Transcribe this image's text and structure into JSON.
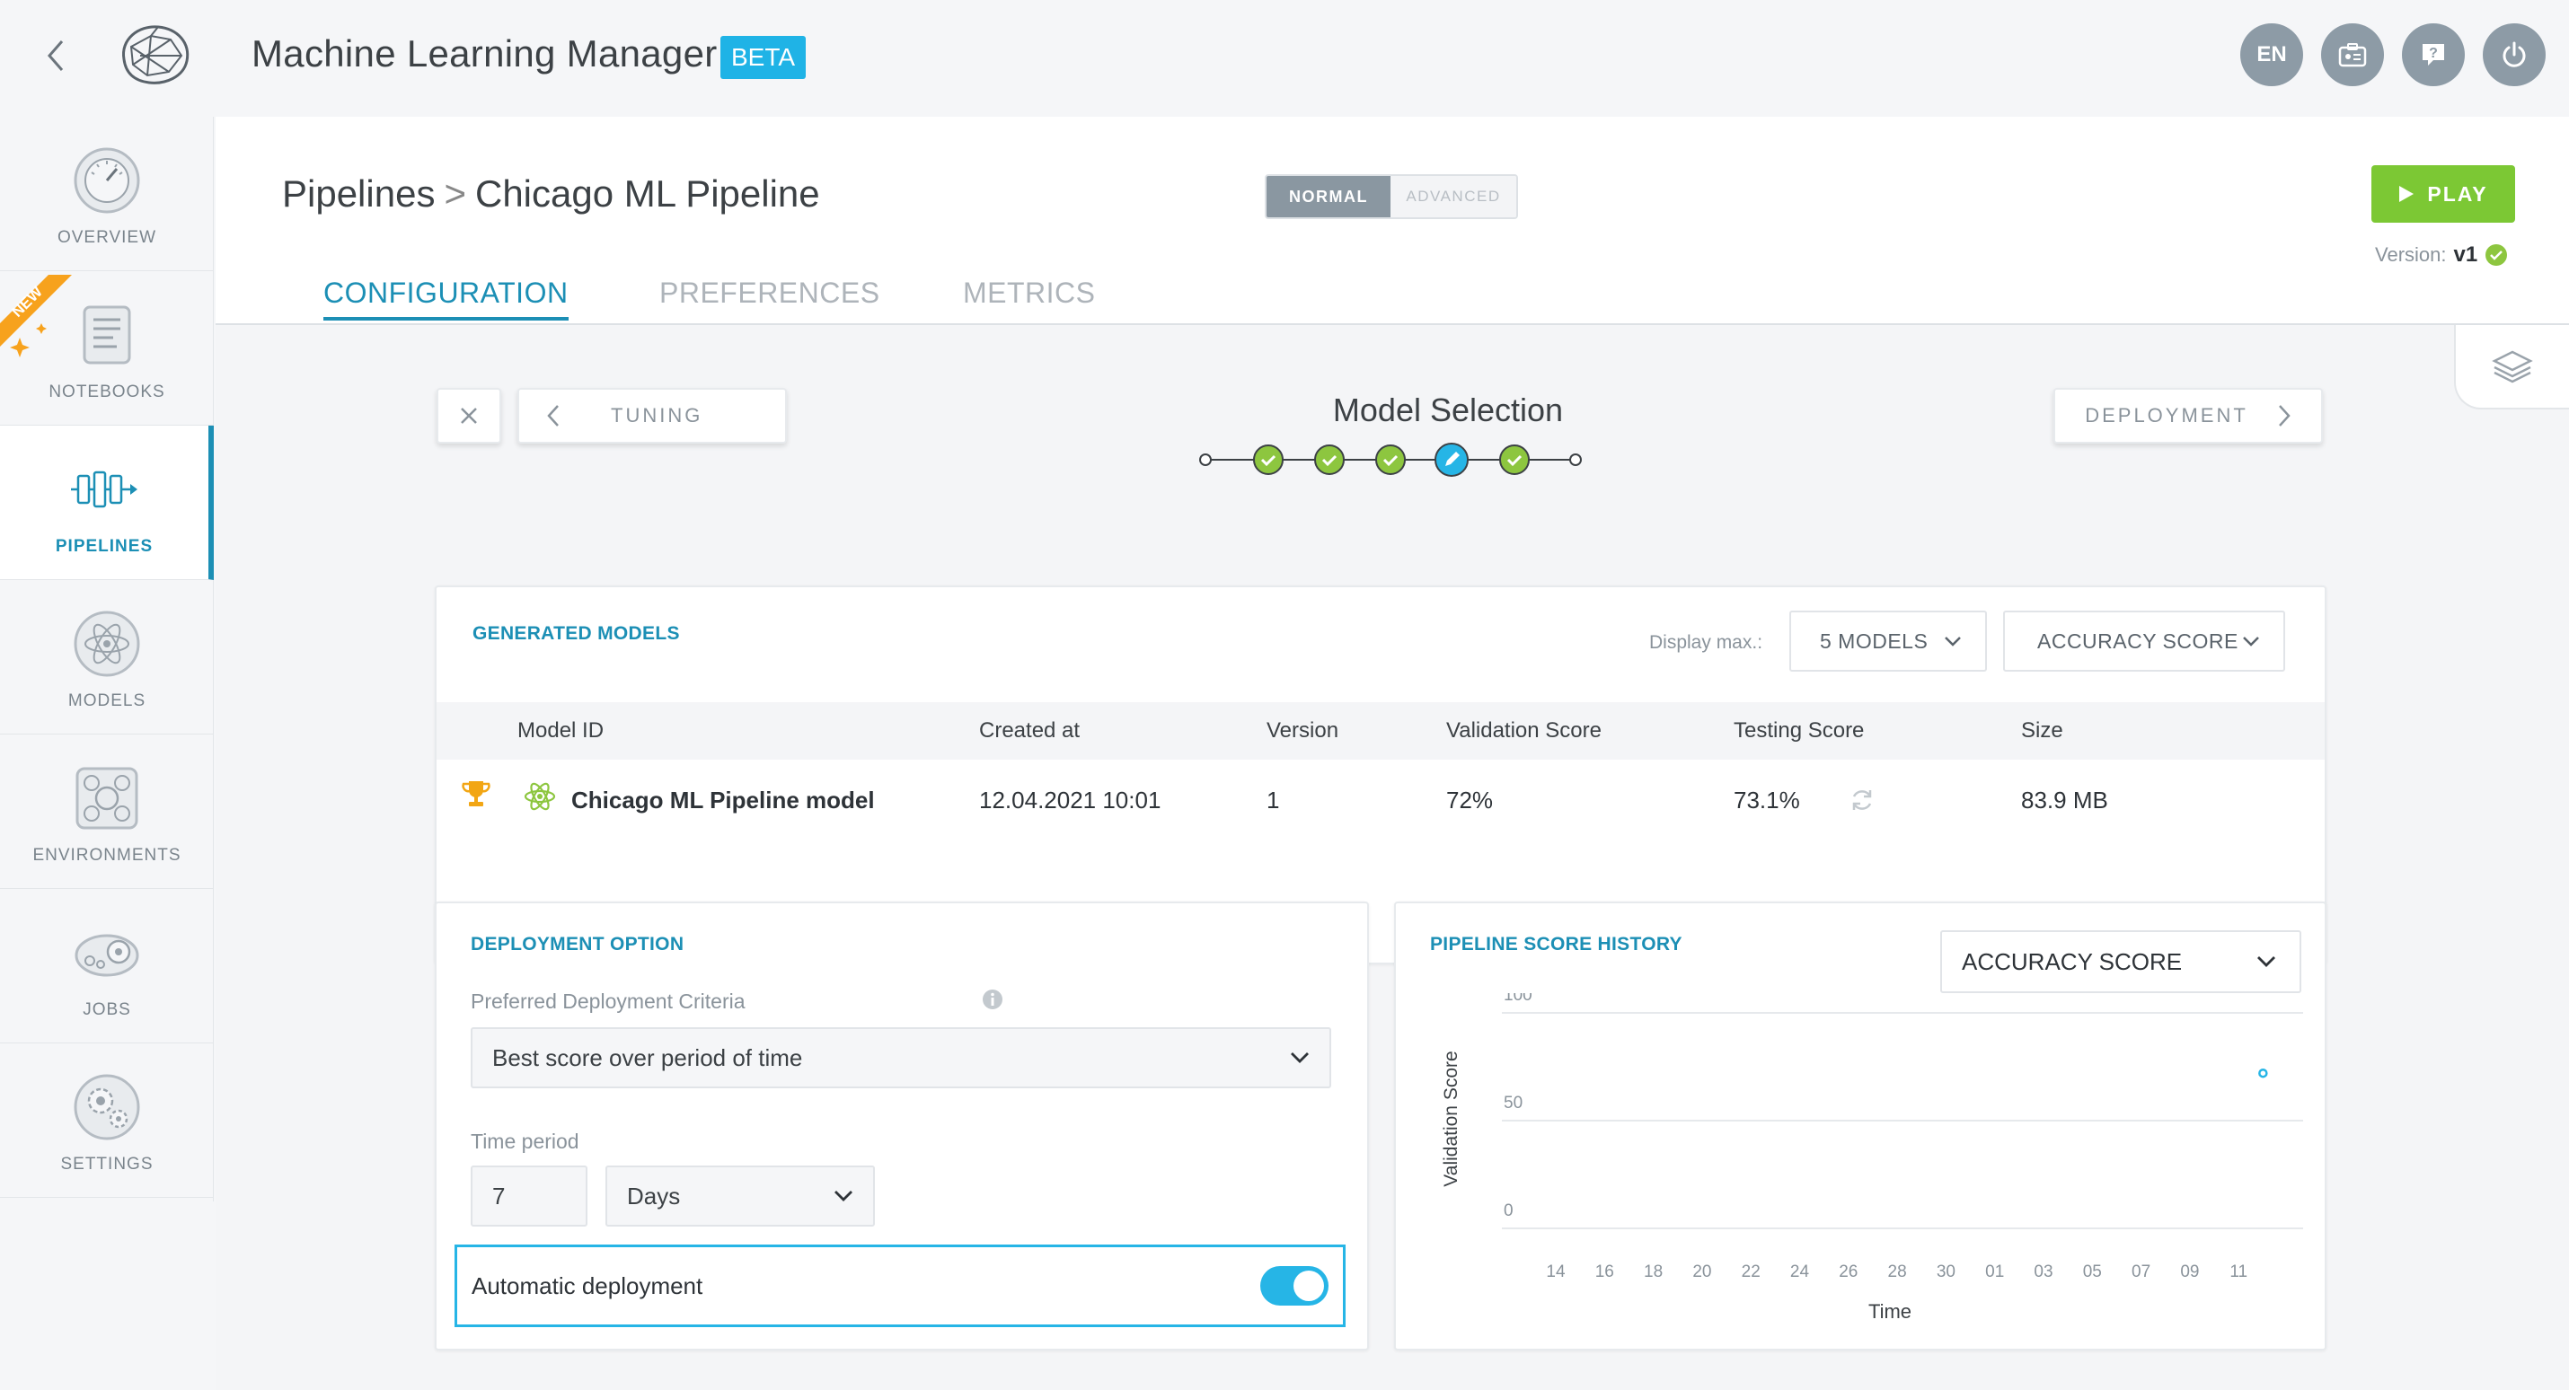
{
  "app": {
    "title": "Machine Learning Manager",
    "badge": "BETA"
  },
  "topbar": {
    "language": "EN"
  },
  "sidebar": {
    "new_ribbon": "NEW",
    "items": [
      {
        "label": "OVERVIEW"
      },
      {
        "label": "NOTEBOOKS"
      },
      {
        "label": "PIPELINES"
      },
      {
        "label": "MODELS"
      },
      {
        "label": "ENVIRONMENTS"
      },
      {
        "label": "JOBS"
      },
      {
        "label": "SETTINGS"
      }
    ]
  },
  "breadcrumb": {
    "root": "Pipelines",
    "separator": ">",
    "current": "Chicago ML Pipeline"
  },
  "mode": {
    "normal": "NORMAL",
    "advanced": "ADVANCED",
    "selected": "NORMAL"
  },
  "play": {
    "label": "PLAY"
  },
  "version": {
    "label": "Version:",
    "value": "v1"
  },
  "tabs": [
    {
      "label": "CONFIGURATION",
      "active": true
    },
    {
      "label": "PREFERENCES",
      "active": false
    },
    {
      "label": "METRICS",
      "active": false
    }
  ],
  "wizard": {
    "prev_label": "TUNING",
    "next_label": "DEPLOYMENT",
    "step_title": "Model Selection",
    "step_states": [
      "start",
      "done",
      "done",
      "done",
      "current",
      "done",
      "end"
    ]
  },
  "generated_models": {
    "title": "GENERATED MODELS",
    "display_max_label": "Display max.:",
    "display_max_value": "5 MODELS",
    "score_type": "ACCURACY SCORE",
    "columns": [
      "Model ID",
      "Created at",
      "Version",
      "Validation Score",
      "Testing Score",
      "Size"
    ],
    "rows": [
      {
        "model_id": "Chicago ML Pipeline model",
        "created_at": "12.04.2021 10:01",
        "version": "1",
        "validation_score": "72%",
        "testing_score": "73.1%",
        "size": "83.9 MB"
      }
    ]
  },
  "deployment": {
    "title": "DEPLOYMENT OPTION",
    "criteria_label": "Preferred Deployment Criteria",
    "criteria_value": "Best score over period of time",
    "period_label": "Time period",
    "period_value": "7",
    "period_unit": "Days",
    "auto_label": "Automatic deployment",
    "auto_enabled": true
  },
  "score_history": {
    "title": "PIPELINE SCORE HISTORY",
    "score_type": "ACCURACY SCORE"
  },
  "chart_data": {
    "type": "scatter",
    "xlabel": "Time",
    "ylabel": "Validation Score",
    "ylim": [
      0,
      100
    ],
    "yticks": [
      0,
      50,
      100
    ],
    "x_ticks": [
      "14",
      "16",
      "18",
      "20",
      "22",
      "24",
      "26",
      "28",
      "30",
      "01",
      "03",
      "05",
      "07",
      "09",
      "11"
    ],
    "points": [
      {
        "x": "12",
        "y": 72
      }
    ],
    "grid": true
  },
  "colors": {
    "accent": "#1c8fb5",
    "play": "#7cc834",
    "success": "#8dc63f",
    "toggle": "#26b5e6"
  }
}
